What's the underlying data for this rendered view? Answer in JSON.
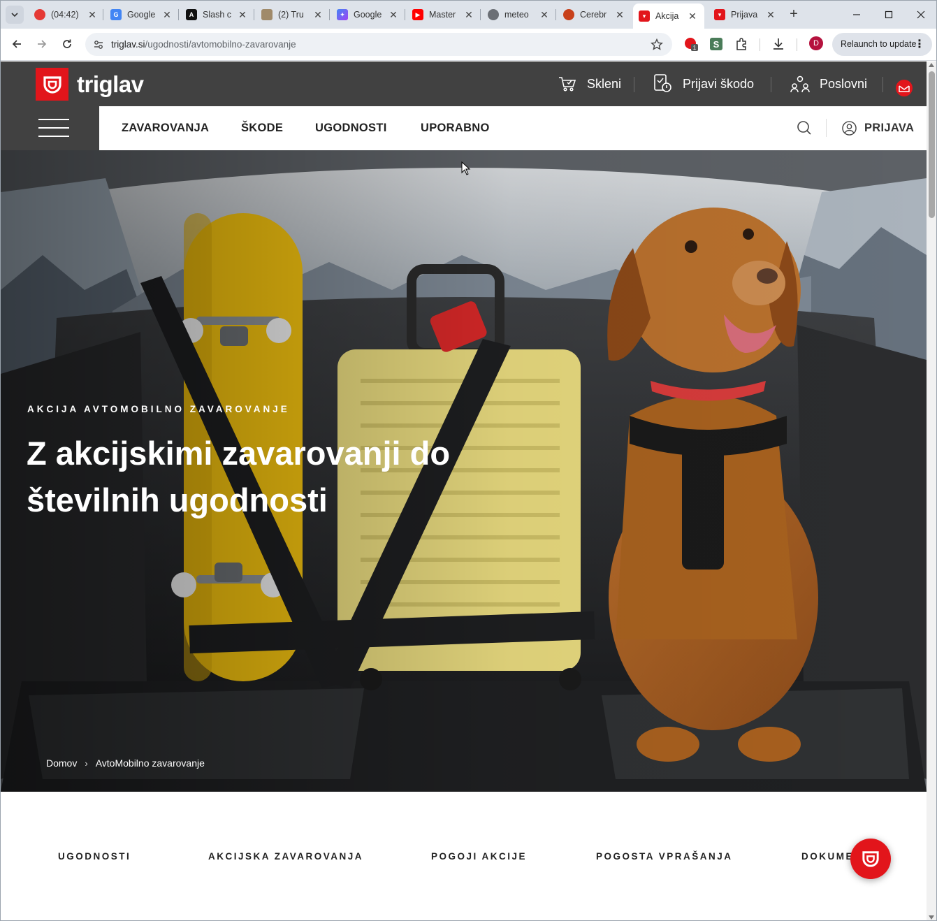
{
  "browser": {
    "tabs": [
      {
        "label": "(04:42)",
        "favicon": "tomato-icon",
        "color": "#e53935"
      },
      {
        "label": "Google",
        "favicon": "translate-icon",
        "color": "#4285f4"
      },
      {
        "label": "Slash c",
        "favicon": "a-letter-icon",
        "color": "#111111"
      },
      {
        "label": "(2) Tru",
        "favicon": "avatar-icon",
        "color": "#a08a6a"
      },
      {
        "label": "Google",
        "favicon": "sparkle-icon",
        "color": "#7b61ff"
      },
      {
        "label": "Master",
        "favicon": "youtube-icon",
        "color": "#ff0000"
      },
      {
        "label": "meteo",
        "favicon": "globe-icon",
        "color": "#6b6f75"
      },
      {
        "label": "Cerebr",
        "favicon": "cerebras-icon",
        "color": "#c8411b"
      },
      {
        "label": "Akcija",
        "favicon": "triglav-icon",
        "color": "#e2151b",
        "active": true
      },
      {
        "label": "Prijava",
        "favicon": "triglav-icon",
        "color": "#e2151b"
      }
    ],
    "url_domain": "triglav.si",
    "url_path": "/ugodnosti/avtomobilno-zavarovanje",
    "profile_initial": "D",
    "extension_badge": "1",
    "relaunch_label": "Relaunch to update"
  },
  "site": {
    "brand": "triglav",
    "utility": {
      "skleni": "Skleni",
      "prijavi": "Prijavi škodo",
      "poslovni": "Poslovni"
    },
    "nav": [
      "ZAVAROVANJA",
      "ŠKODE",
      "UGODNOSTI",
      "UPORABNO"
    ],
    "login": "PRIJAVA"
  },
  "hero": {
    "eyebrow": "AKCIJA AVTOMOBILNO ZAVAROVANJE",
    "headline_line1": "Z akcijskimi zavarovanji do",
    "headline_line2": "številnih ugodnosti",
    "breadcrumb": [
      "Domov",
      "AvtoMobilno zavarovanje"
    ]
  },
  "subnav": [
    "UGODNOSTI",
    "AKCIJSKA ZAVAROVANJA",
    "POGOJI AKCIJE",
    "POGOSTA VPRAŠANJA",
    "DOKUMEN"
  ],
  "colors": {
    "brand_red": "#e2151b",
    "header_dark": "#414141"
  }
}
